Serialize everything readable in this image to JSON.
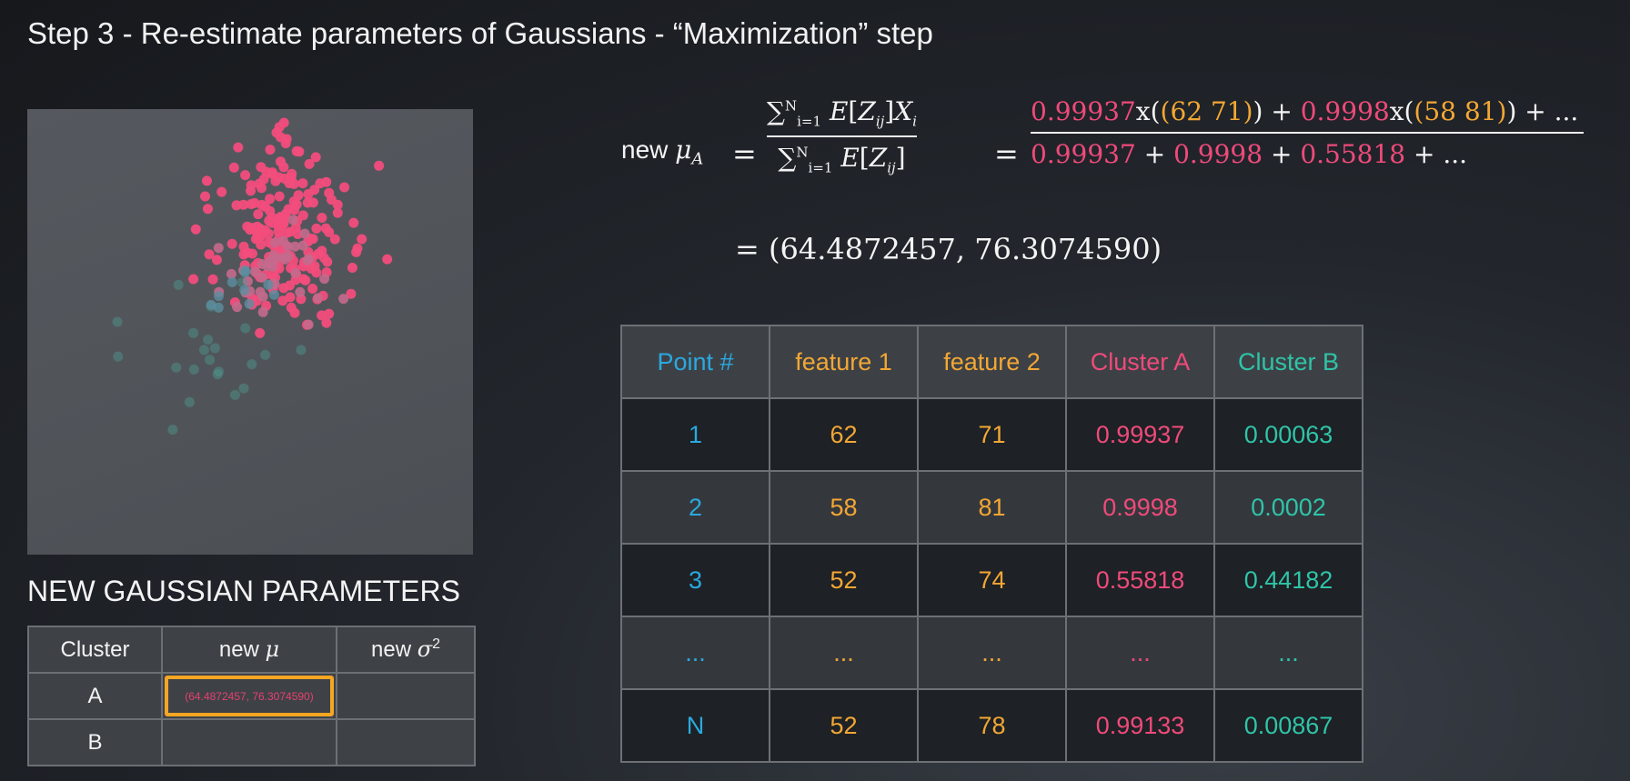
{
  "title": "Step 3 - Re-estimate parameters of Gaussians - “Maximization” step",
  "formula": {
    "label": "new",
    "mu_symbol": "μ",
    "mu_sub": "A",
    "numerator_general": "∑ E[Z",
    "sum_upper": "N",
    "sum_lower": "i=1",
    "numerator_terms": [
      {
        "weight": "0.99937",
        "point": "(62 71)"
      },
      {
        "weight": "0.9998",
        "point": "(58 81)"
      }
    ],
    "denominator_terms": [
      "0.99937",
      "0.9998",
      "0.55818"
    ],
    "ellipsis": "...",
    "result": "= (64.4872457, 76.3074590)"
  },
  "params": {
    "heading": "NEW GAUSSIAN PARAMETERS",
    "col_cluster": "Cluster",
    "col_mu_prefix": "new",
    "col_mu_symbol": "μ",
    "col_sigma_prefix": "new",
    "col_sigma_symbol": "σ",
    "col_sigma_exp": "2",
    "rows": [
      {
        "cluster": "A",
        "mu": "(64.4872457, 76.3074590)",
        "sigma": ""
      },
      {
        "cluster": "B",
        "mu": "",
        "sigma": ""
      }
    ]
  },
  "table": {
    "headers": [
      "Point #",
      "feature 1",
      "feature 2",
      "Cluster A",
      "Cluster B"
    ],
    "rows": [
      [
        "1",
        "62",
        "71",
        "0.99937",
        "0.00063"
      ],
      [
        "2",
        "58",
        "81",
        "0.9998",
        "0.0002"
      ],
      [
        "3",
        "52",
        "74",
        "0.55818",
        "0.44182"
      ],
      [
        "...",
        "...",
        "...",
        "...",
        "..."
      ],
      [
        "N",
        "52",
        "78",
        "0.99133",
        "0.00867"
      ]
    ]
  },
  "colors": {
    "cluster_a": "#ef4a7a",
    "cluster_b": "#2fc4a8",
    "feature": "#f3a734",
    "point": "#2aa9df",
    "highlight": "#f5a623"
  }
}
